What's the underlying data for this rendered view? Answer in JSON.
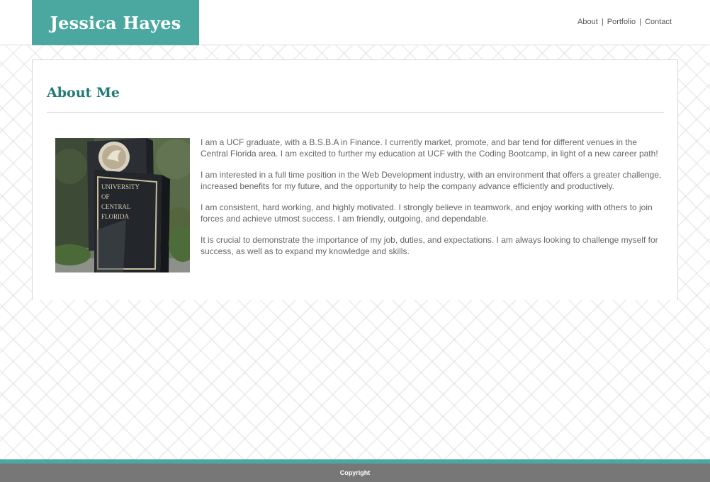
{
  "site": {
    "name": "Jessica Hayes",
    "brand_color": "#4aa8a0",
    "title_color": "#1f7a78",
    "footer_color": "#777777"
  },
  "nav": {
    "items": [
      {
        "label": "About"
      },
      {
        "label": "Portfolio"
      },
      {
        "label": "Contact"
      }
    ],
    "separator": "|"
  },
  "about": {
    "title": "About Me",
    "photo_icon": "ucf-campus-sign-photo",
    "photo_text": "UNIVERSITY OF CENTRAL FLORIDA",
    "paragraphs": [
      "I am a UCF graduate, with a B.S.B.A in Finance. I currently market, promote, and bar tend for different venues in the Central Florida area. I am excited to further my education at UCF with the Coding Bootcamp, in light of a new career path!",
      "I am interested in a full time position in the Web Development industry, with an environment that offers a greater challenge, increased benefits for my future, and the opportunity to help the company advance efficiently and productively.",
      "I am consistent, hard working, and highly motivated. I strongly believe in teamwork, and enjoy working with others to join forces and achieve utmost success. I am friendly, outgoing, and dependable.",
      "It is crucial to demonstrate the importance of my job, duties, and expectations. I am always looking to challenge myself for success, as well as to expand my knowledge and skills."
    ]
  },
  "footer": {
    "copyright": "Copyright"
  }
}
